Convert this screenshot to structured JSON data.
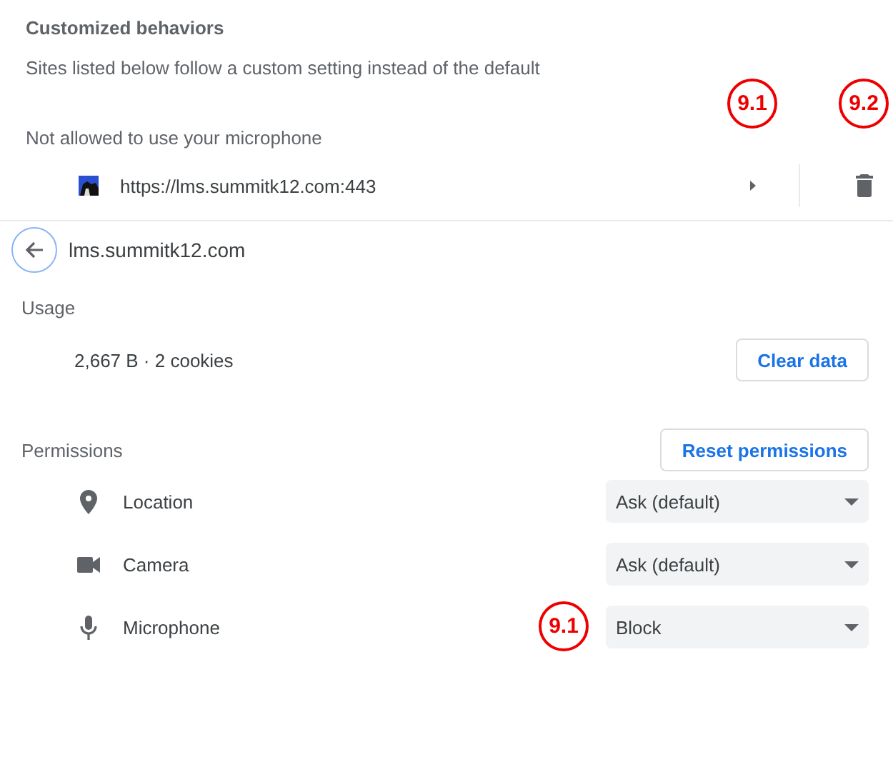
{
  "exceptions": {
    "title": "Customized behaviors",
    "description": "Sites listed below follow a custom setting instead of the default",
    "category": "Not allowed to use your microphone",
    "sites": [
      {
        "url": "https://lms.summitk12.com:443",
        "open_callout": "9.1",
        "remove_callout": "9.2"
      }
    ]
  },
  "site": {
    "host": "lms.summitk12.com",
    "usage": {
      "heading": "Usage",
      "summary": "2,667 B · 2 cookies",
      "button": "Clear data"
    },
    "permissions": {
      "heading": "Permissions",
      "reset_button": "Reset permissions",
      "items": [
        {
          "kind": "location",
          "label": "Location",
          "value": "Ask (default)"
        },
        {
          "kind": "camera",
          "label": "Camera",
          "value": "Ask (default)"
        },
        {
          "kind": "microphone",
          "label": "Microphone",
          "value": "Block",
          "callout": "9.1"
        }
      ]
    }
  }
}
